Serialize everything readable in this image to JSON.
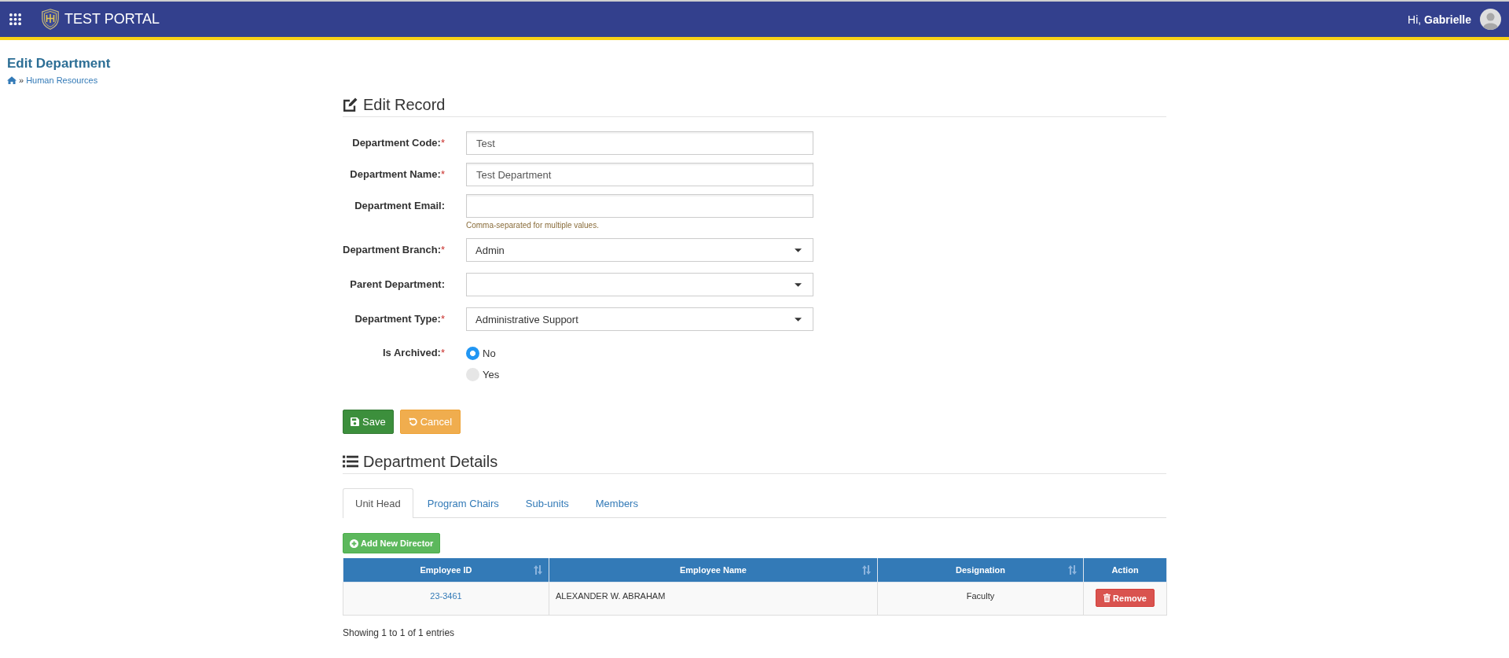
{
  "header": {
    "app_title": "TEST PORTAL",
    "greeting": "Hi, **Gabrielle**"
  },
  "page": {
    "title": "Edit Department",
    "breadcrumb": {
      "separator": "»",
      "link": "Human Resources"
    }
  },
  "edit_record": {
    "heading": "Edit Record",
    "fields": [
      {
        "kind": "text",
        "label": "Department Code:",
        "required_mark": "*",
        "value": "Test"
      },
      {
        "kind": "text",
        "label": "Department Name:",
        "required_mark": "*",
        "value": "Test Department"
      },
      {
        "kind": "text",
        "label": "Department Email:",
        "help": "Comma-separated for multiple values."
      },
      {
        "kind": "select",
        "label": "Department Branch:",
        "required_mark": "*",
        "value": "Admin"
      },
      {
        "kind": "select",
        "label": "Parent Department:"
      },
      {
        "kind": "select",
        "label": "Department Type:",
        "required_mark": "*",
        "value": "Administrative Support"
      },
      {
        "kind": "radio",
        "label": "Is Archived:",
        "required_mark": "*",
        "options": [
          {
            "label": "No",
            "selected": true
          },
          {
            "label": "Yes",
            "selected": false
          }
        ]
      }
    ]
  },
  "actions": [
    {
      "kind": "save",
      "label": "Save"
    },
    {
      "kind": "cancel",
      "label": "Cancel"
    }
  ],
  "details": {
    "heading": "Department Details",
    "tabs": [
      {
        "label": "Unit Head",
        "selected": true
      },
      {
        "label": "Program Chairs",
        "selected": false
      },
      {
        "label": "Sub-units",
        "selected": false
      },
      {
        "label": "Members",
        "selected": false
      }
    ],
    "add_button": "Add New Director",
    "table": {
      "columns": [
        {
          "label": "Employee ID",
          "sortable": true
        },
        {
          "label": "Employee Name",
          "sortable": true
        },
        {
          "label": "Designation",
          "sortable": true
        },
        {
          "label": "Action",
          "sortable": false
        }
      ],
      "rows": [
        {
          "cells": [
            {
              "kind": "link",
              "text": "23-3461"
            },
            {
              "kind": "text",
              "text": "ALEXANDER W. ABRAHAM"
            },
            {
              "kind": "text",
              "text": "Faculty"
            },
            {
              "kind": "button",
              "text": "Remove"
            }
          ]
        }
      ]
    },
    "info": "Showing 1 to 1 of 1 entries"
  }
}
